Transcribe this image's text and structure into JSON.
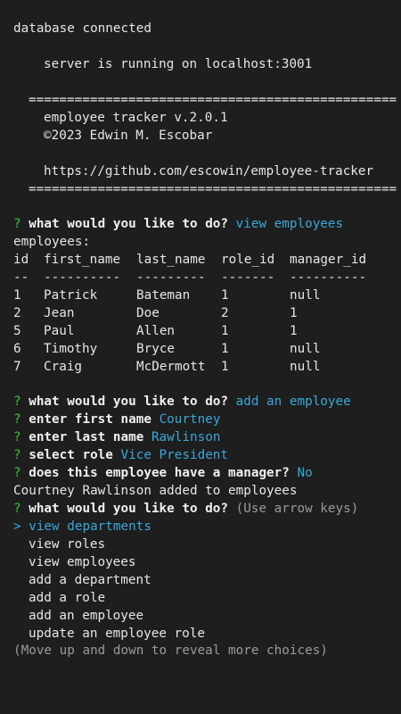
{
  "boot": {
    "db": "database connected",
    "server": "server is running on localhost:3001"
  },
  "banner": {
    "rule": "================================================",
    "title": "employee tracker v.2.0.1",
    "copyright": "©2023 Edwin M. Escobar",
    "url": "https://github.com/escowin/employee-tracker"
  },
  "prompt_marker": "?",
  "prompt1": {
    "question": "what would you like to do?",
    "answer": "view employees"
  },
  "employees": {
    "heading": "employees:",
    "columns": [
      "id",
      "first_name",
      "last_name",
      "role_id",
      "manager_id"
    ],
    "separators": [
      "--",
      "----------",
      "---------",
      "-------",
      "----------"
    ],
    "rows": [
      [
        "1",
        "Patrick",
        "Bateman",
        "1",
        "null"
      ],
      [
        "2",
        "Jean",
        "Doe",
        "2",
        "1"
      ],
      [
        "5",
        "Paul",
        "Allen",
        "1",
        "1"
      ],
      [
        "6",
        "Timothy",
        "Bryce",
        "1",
        "null"
      ],
      [
        "7",
        "Craig",
        "McDermott",
        "1",
        "null"
      ]
    ]
  },
  "prompt2": {
    "question": "what would you like to do?",
    "answer": "add an employee"
  },
  "prompt3": {
    "question": "enter first name",
    "answer": "Courtney"
  },
  "prompt4": {
    "question": "enter last name",
    "answer": "Rawlinson"
  },
  "prompt5": {
    "question": "select role",
    "answer": "Vice President"
  },
  "prompt6": {
    "question": "does this employee have a manager?",
    "answer": "No"
  },
  "result": "Courtney Rawlinson added to employees",
  "prompt7": {
    "question": "what would you like to do?",
    "hint": "(Use arrow keys)"
  },
  "menu": {
    "pointer": ">",
    "items": [
      "view departments",
      "view roles",
      "view employees",
      "add a department",
      "add a role",
      "add an employee",
      "update an employee role"
    ],
    "footer": "(Move up and down to reveal more choices)"
  }
}
